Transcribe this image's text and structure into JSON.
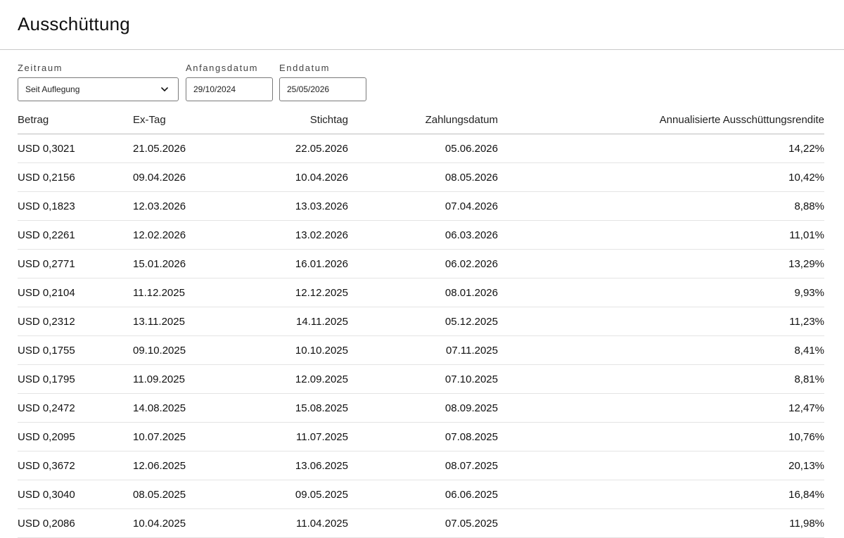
{
  "page": {
    "title": "Ausschüttung"
  },
  "filters": {
    "zeitraum": {
      "label": "Zeitraum",
      "value": "Seit Auflegung",
      "icon": "chevron-down-icon"
    },
    "anfangsdatum": {
      "label": "Anfangsdatum",
      "value": "29/10/2024"
    },
    "enddatum": {
      "label": "Enddatum",
      "value": "25/05/2026"
    }
  },
  "table": {
    "columns": [
      "Betrag",
      "Ex-Tag",
      "Stichtag",
      "Zahlungsdatum",
      "Annualisierte Ausschüttungsrendite"
    ],
    "rows": [
      [
        "USD 0,3021",
        "21.05.2026",
        "22.05.2026",
        "05.06.2026",
        "14,22%"
      ],
      [
        "USD 0,2156",
        "09.04.2026",
        "10.04.2026",
        "08.05.2026",
        "10,42%"
      ],
      [
        "USD 0,1823",
        "12.03.2026",
        "13.03.2026",
        "07.04.2026",
        "8,88%"
      ],
      [
        "USD 0,2261",
        "12.02.2026",
        "13.02.2026",
        "06.03.2026",
        "11,01%"
      ],
      [
        "USD 0,2771",
        "15.01.2026",
        "16.01.2026",
        "06.02.2026",
        "13,29%"
      ],
      [
        "USD 0,2104",
        "11.12.2025",
        "12.12.2025",
        "08.01.2026",
        "9,93%"
      ],
      [
        "USD 0,2312",
        "13.11.2025",
        "14.11.2025",
        "05.12.2025",
        "11,23%"
      ],
      [
        "USD 0,1755",
        "09.10.2025",
        "10.10.2025",
        "07.11.2025",
        "8,41%"
      ],
      [
        "USD 0,1795",
        "11.09.2025",
        "12.09.2025",
        "07.10.2025",
        "8,81%"
      ],
      [
        "USD 0,2472",
        "14.08.2025",
        "15.08.2025",
        "08.09.2025",
        "12,47%"
      ],
      [
        "USD 0,2095",
        "10.07.2025",
        "11.07.2025",
        "07.08.2025",
        "10,76%"
      ],
      [
        "USD 0,3672",
        "12.06.2025",
        "13.06.2025",
        "08.07.2025",
        "20,13%"
      ],
      [
        "USD 0,3040",
        "08.05.2025",
        "09.05.2025",
        "06.06.2025",
        "16,84%"
      ],
      [
        "USD 0,2086",
        "10.04.2025",
        "11.04.2025",
        "07.05.2025",
        "11,98%"
      ]
    ]
  },
  "colors": {
    "text": "#111111",
    "border": "#7a7a7a",
    "divider": "#c9c9c9"
  }
}
